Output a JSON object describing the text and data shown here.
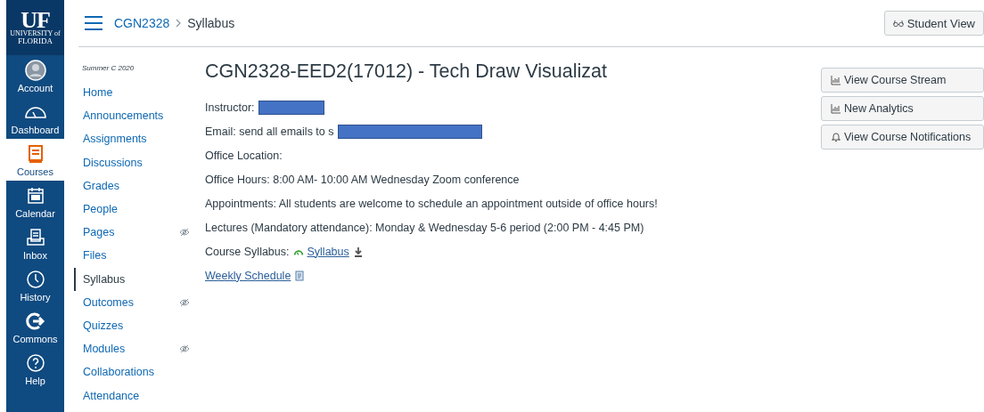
{
  "global_nav": {
    "logo": {
      "title": "UF",
      "subtitle": "UNIVERSITY of",
      "name": "FLORIDA"
    },
    "items": [
      {
        "kind": "account",
        "label": "Account",
        "selected": false
      },
      {
        "kind": "dashboard",
        "label": "Dashboard",
        "selected": false
      },
      {
        "kind": "courses",
        "label": "Courses",
        "selected": true
      },
      {
        "kind": "calendar",
        "label": "Calendar",
        "selected": false
      },
      {
        "kind": "inbox",
        "label": "Inbox",
        "selected": false
      },
      {
        "kind": "history",
        "label": "History",
        "selected": false
      },
      {
        "kind": "commons",
        "label": "Commons",
        "selected": false
      },
      {
        "kind": "help",
        "label": "Help",
        "selected": false
      }
    ]
  },
  "breadcrumb": [
    "CGN2328",
    "Syllabus"
  ],
  "student_view_button": "Student View",
  "course_nav": {
    "term": "Summer C 2020",
    "items": [
      {
        "label": "Home",
        "selected": false,
        "hidden": false
      },
      {
        "label": "Announcements",
        "selected": false,
        "hidden": false
      },
      {
        "label": "Assignments",
        "selected": false,
        "hidden": false
      },
      {
        "label": "Discussions",
        "selected": false,
        "hidden": false
      },
      {
        "label": "Grades",
        "selected": false,
        "hidden": false
      },
      {
        "label": "People",
        "selected": false,
        "hidden": false
      },
      {
        "label": "Pages",
        "selected": false,
        "hidden": true
      },
      {
        "label": "Files",
        "selected": false,
        "hidden": false
      },
      {
        "label": "Syllabus",
        "selected": true,
        "hidden": false
      },
      {
        "label": "Outcomes",
        "selected": false,
        "hidden": true
      },
      {
        "label": "Quizzes",
        "selected": false,
        "hidden": false
      },
      {
        "label": "Modules",
        "selected": false,
        "hidden": true
      },
      {
        "label": "Collaborations",
        "selected": false,
        "hidden": false
      },
      {
        "label": "Attendance",
        "selected": false,
        "hidden": false
      }
    ]
  },
  "content": {
    "title": "CGN2328-EED2(17012) - Tech Draw Visualizat",
    "lines": [
      {
        "kind": "text",
        "text": "Instructor:",
        "redacted": true
      },
      {
        "kind": "text",
        "text": "Email:  send all emails to s",
        "redacted": true
      },
      {
        "kind": "text",
        "text": "Office Location:",
        "redacted": false
      },
      {
        "kind": "text",
        "text": "Office Hours: 8:00 AM- 10:00 AM  Wednesday Zoom conference",
        "redacted": false
      },
      {
        "kind": "text",
        "text": "Appointments: All students are welcome to schedule an appointment outside of office hours!",
        "redacted": false
      },
      {
        "kind": "text",
        "text": "Lectures (Mandatory attendance): Monday & Wednesday 5-6 period (2:00 PM - 4:45 PM)",
        "redacted": false
      },
      {
        "kind": "file",
        "text": "Course Syllabus:",
        "link": "Syllabus"
      },
      {
        "kind": "link",
        "link": "Weekly Schedule"
      }
    ]
  },
  "aside_buttons": [
    {
      "kind": "chart",
      "label": "View Course Stream"
    },
    {
      "kind": "chart",
      "label": "New Analytics"
    },
    {
      "kind": "bell",
      "label": "View Course Notifications"
    }
  ]
}
